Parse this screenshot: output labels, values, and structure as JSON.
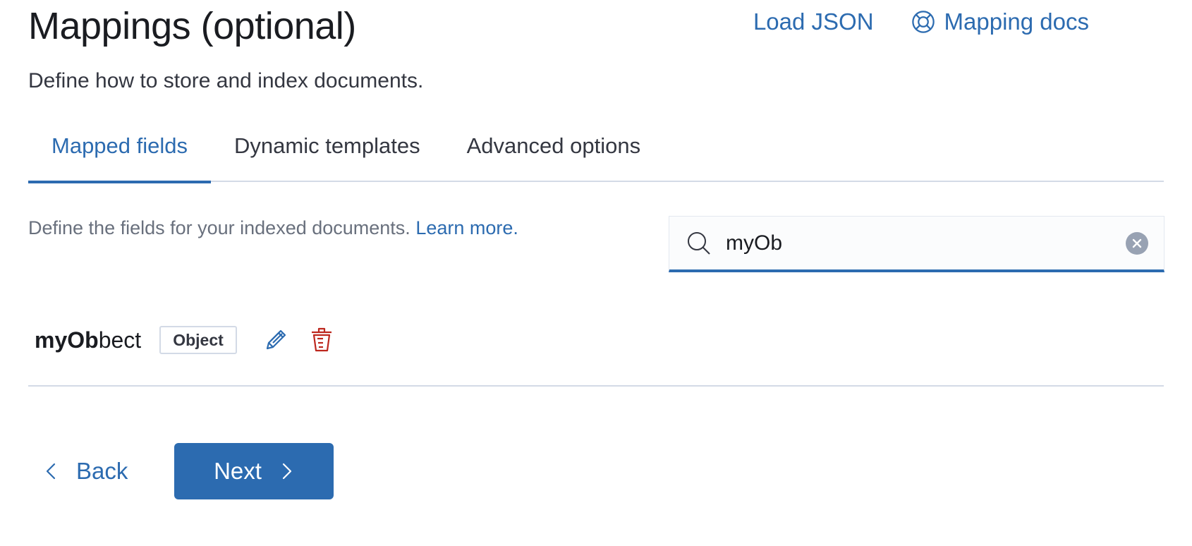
{
  "header": {
    "title": "Mappings (optional)",
    "description": "Define how to store and index documents.",
    "load_json_label": "Load JSON",
    "mapping_docs_label": "Mapping docs"
  },
  "tabs": [
    {
      "label": "Mapped fields",
      "active": true
    },
    {
      "label": "Dynamic templates",
      "active": false
    },
    {
      "label": "Advanced options",
      "active": false
    }
  ],
  "fields_panel": {
    "description": "Define the fields for your indexed documents.",
    "learn_more_label": "Learn more.",
    "search": {
      "value": "myOb",
      "placeholder": ""
    },
    "fields": [
      {
        "name_match": "myOb",
        "name_rest": "bect",
        "type": "Object"
      }
    ]
  },
  "footer": {
    "back_label": "Back",
    "next_label": "Next"
  },
  "colors": {
    "accent": "#2c6bb0",
    "danger": "#bd271e",
    "border": "#d3dae6"
  },
  "icons": [
    "help-lifebuoy-icon",
    "search-icon",
    "clear-icon",
    "pencil-icon",
    "trash-icon",
    "chevron-left-icon",
    "chevron-right-icon"
  ]
}
